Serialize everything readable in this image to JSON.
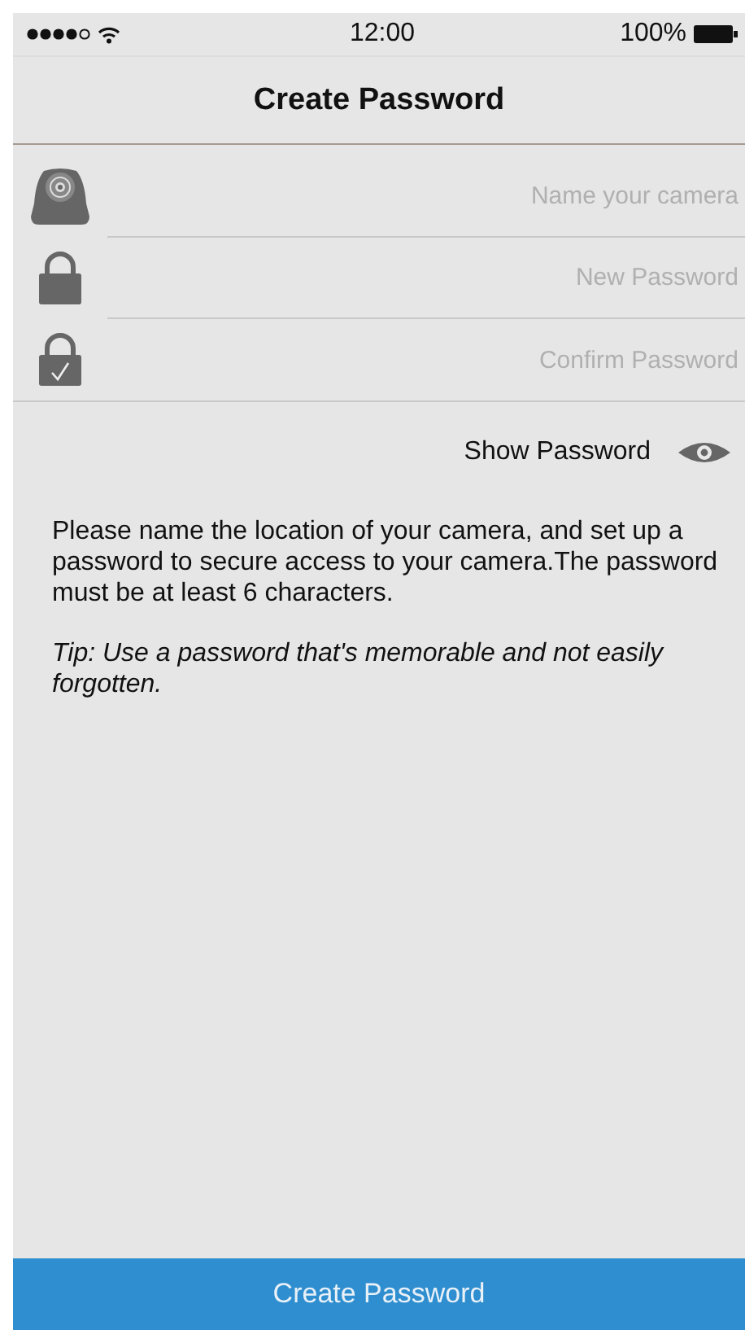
{
  "status_bar": {
    "time": "12:00",
    "battery": "100%"
  },
  "nav": {
    "title": "Create Password"
  },
  "fields": [
    {
      "kind": "camera",
      "placeholder": "Name your camera"
    },
    {
      "kind": "lock",
      "placeholder": "New Password"
    },
    {
      "kind": "lock-check",
      "placeholder": "Confirm Password"
    }
  ],
  "show_password": {
    "label": "Show Password"
  },
  "instructions": "Please name the location of your camera, and set up a password to secure access to your camera.The password must be at least 6 characters.",
  "tip": "Tip: Use a password that's memorable and not easily forgotten.",
  "primary_button": "Create Password"
}
